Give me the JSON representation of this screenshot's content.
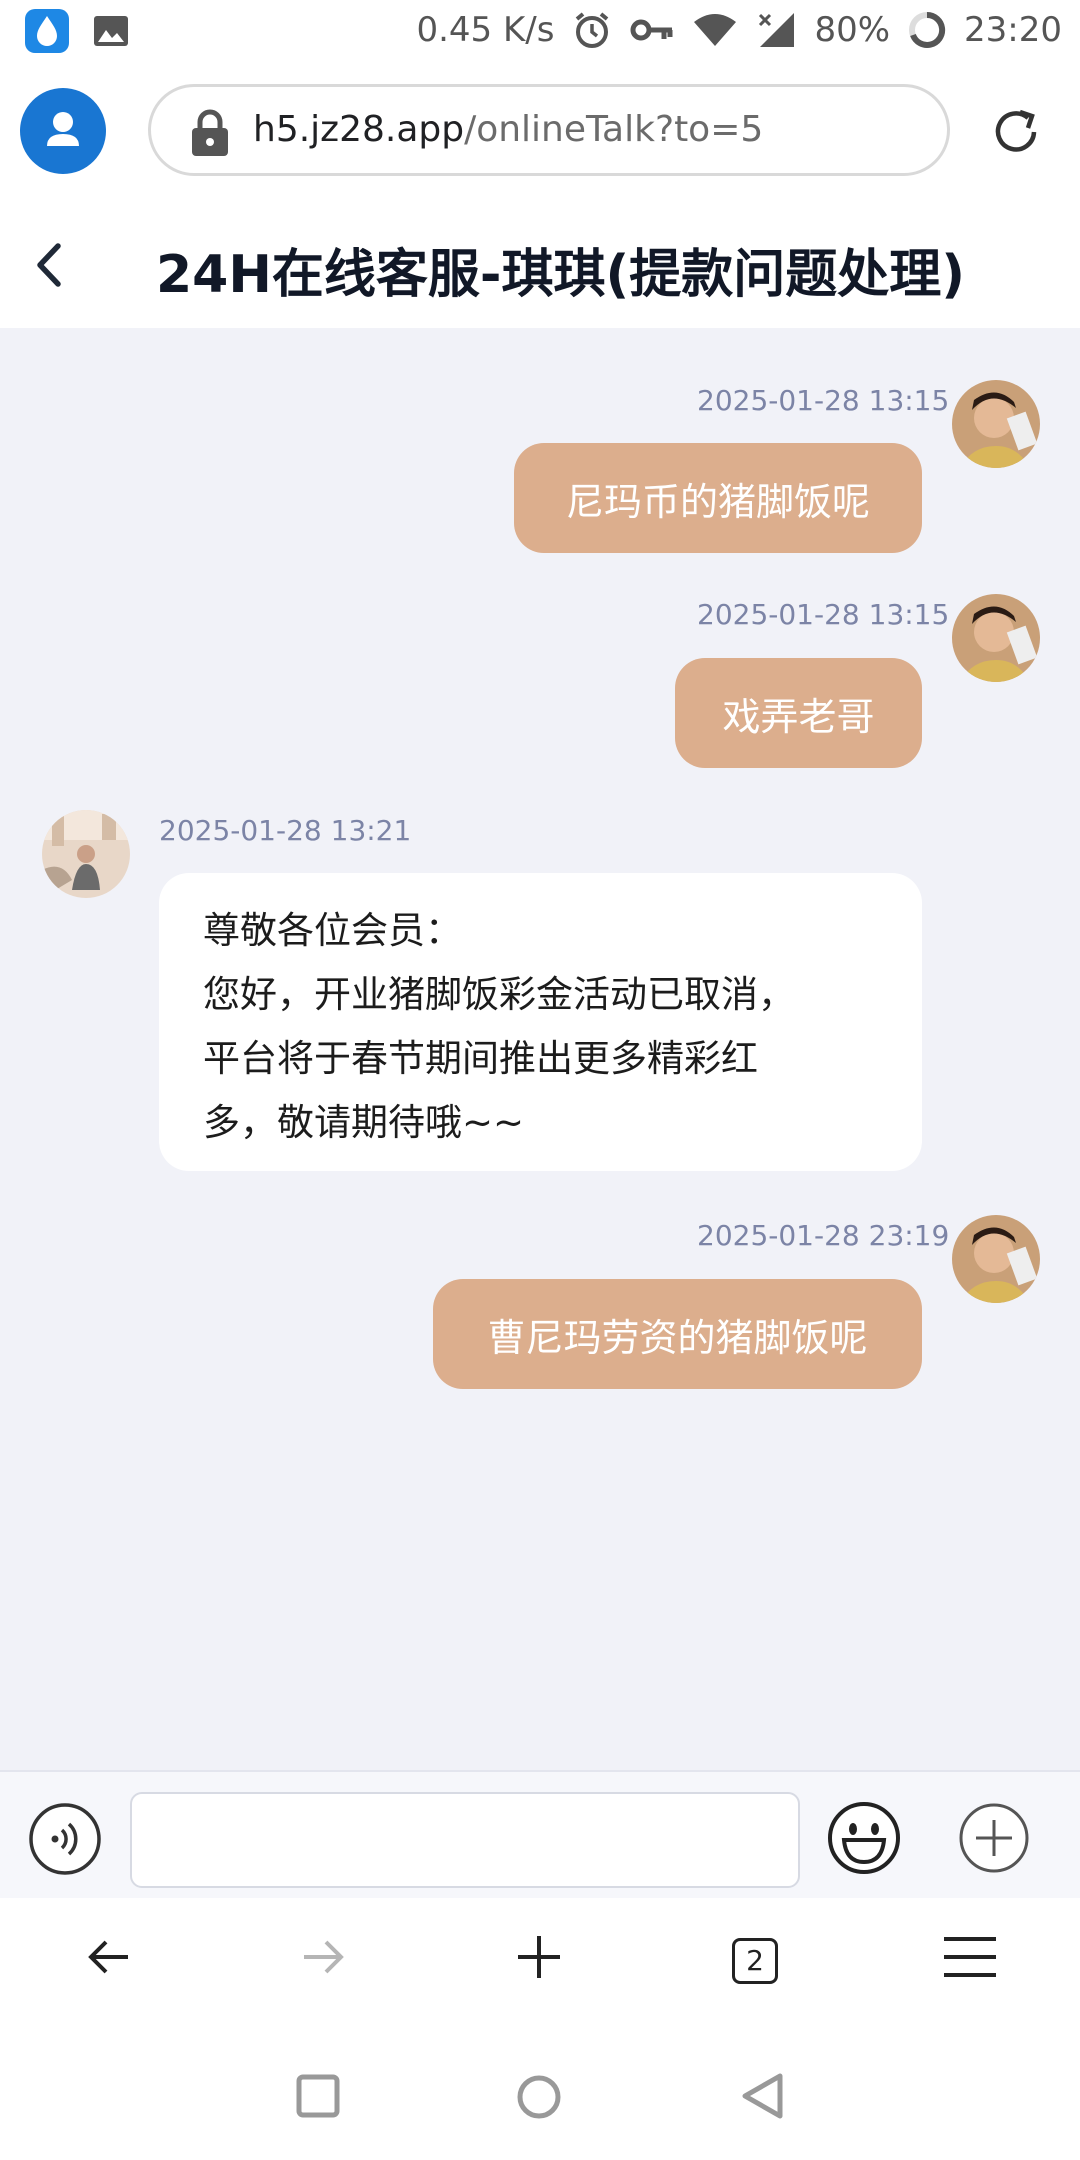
{
  "status_bar": {
    "network_speed": "0.45 K/s",
    "battery": "80%",
    "time": "23:20",
    "icons": [
      "water-drop-icon",
      "gallery-icon",
      "alarm-icon",
      "vpn-key-icon",
      "wifi-icon",
      "signal-icon",
      "battery-icon"
    ]
  },
  "browser": {
    "url_host": "h5.jz28.app",
    "url_path": "/onlineTalk?to=5",
    "tab_count": "2"
  },
  "chat": {
    "title": "24H在线客服-琪琪(提款问题处理)",
    "messages": [
      {
        "direction": "out",
        "time": "2025-01-28 13:15",
        "text": "尼玛币的猪脚饭呢"
      },
      {
        "direction": "out",
        "time": "2025-01-28 13:15",
        "text": "戏弄老哥"
      },
      {
        "direction": "in",
        "time": "2025-01-28 13:21",
        "lines": [
          "尊敬各位会员：",
          "您好，开业猪脚饭彩金活动已取消，",
          "平台将于春节期间推出更多精彩红",
          "多，敬请期待哦~~"
        ]
      },
      {
        "direction": "out",
        "time": "2025-01-28 23:19",
        "text": "曹尼玛劳资的猪脚饭呢"
      }
    ]
  },
  "input": {
    "value": "",
    "placeholder": ""
  },
  "colors": {
    "accent_blue": "#1976d2",
    "outgoing_bubble": "#dcae8d",
    "chat_background": "#f1f2f8",
    "timestamp": "#7c84a6"
  }
}
